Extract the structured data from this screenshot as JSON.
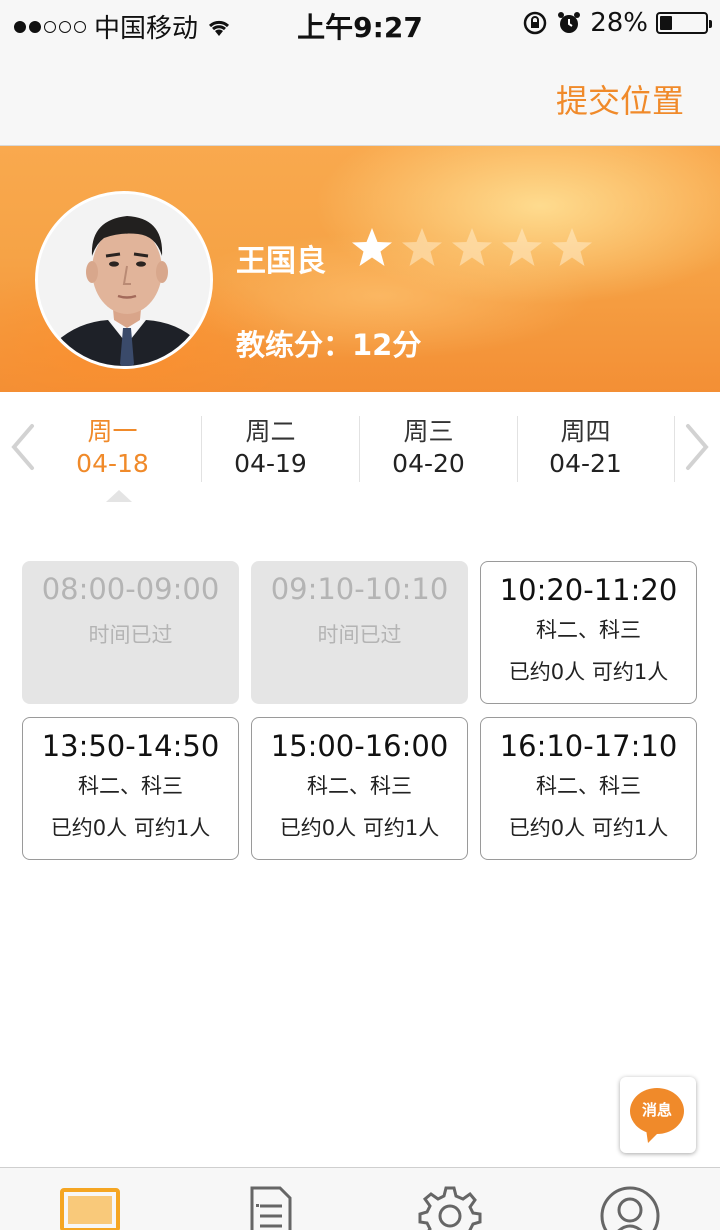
{
  "status_bar": {
    "carrier": "中国移动",
    "time": "上午9:27",
    "battery": "28%",
    "battery_level": 0.28,
    "signal_bars_filled": 2,
    "signal_bars_total": 5
  },
  "nav": {
    "submit_location_label": "提交位置"
  },
  "profile": {
    "name": "王国良",
    "rating": 1,
    "rating_max": 5,
    "score_label": "教练分：12分"
  },
  "dates": {
    "days": [
      {
        "weekday": "周一",
        "date": "04-18",
        "active": true
      },
      {
        "weekday": "周二",
        "date": "04-19",
        "active": false
      },
      {
        "weekday": "周三",
        "date": "04-20",
        "active": false
      },
      {
        "weekday": "周四",
        "date": "04-21",
        "active": false
      }
    ]
  },
  "slots": [
    {
      "time": "08:00-09:00",
      "status": "时间已过",
      "past": true
    },
    {
      "time": "09:10-10:10",
      "status": "时间已过",
      "past": true
    },
    {
      "time": "10:20-11:20",
      "subjects": "科二、科三",
      "capacity": "已约0人 可约1人",
      "past": false
    },
    {
      "time": "13:50-14:50",
      "subjects": "科二、科三",
      "capacity": "已约0人 可约1人",
      "past": false
    },
    {
      "time": "15:00-16:00",
      "subjects": "科二、科三",
      "capacity": "已约0人 可约1人",
      "past": false
    },
    {
      "time": "16:10-17:10",
      "subjects": "科二、科三",
      "capacity": "已约0人 可约1人",
      "past": false
    }
  ],
  "message_button": {
    "label": "消息"
  },
  "tabs": [
    {
      "icon": "monitor-icon",
      "active": true
    },
    {
      "icon": "document-list-icon",
      "active": false
    },
    {
      "icon": "gear-icon",
      "active": false
    },
    {
      "icon": "user-profile-icon",
      "active": false
    }
  ],
  "colors": {
    "accent": "#f08a2a",
    "banner": "#f6a346",
    "past_slot_bg": "#e5e5e5"
  }
}
